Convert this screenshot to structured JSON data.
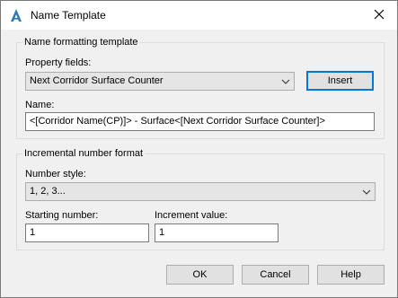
{
  "window": {
    "title": "Name Template",
    "app_icon": "autocad-a-icon",
    "close_icon": "close-x-icon"
  },
  "name_formatting": {
    "group_title": "Name formatting template",
    "property_fields_label": "Property fields:",
    "property_fields_value": "Next Corridor Surface Counter",
    "insert_label": "Insert",
    "name_label": "Name:",
    "name_value": "<[Corridor Name(CP)]> - Surface<[Next Corridor Surface Counter]>"
  },
  "incremental": {
    "group_title": "Incremental number format",
    "number_style_label": "Number style:",
    "number_style_value": "1, 2, 3...",
    "starting_number_label": "Starting number:",
    "starting_number_value": "1",
    "increment_value_label": "Increment value:",
    "increment_value_value": "1"
  },
  "buttons": {
    "ok": "OK",
    "cancel": "Cancel",
    "help": "Help"
  },
  "colors": {
    "accent": "#0078d7",
    "dialog_bg": "#f0f0f0"
  }
}
